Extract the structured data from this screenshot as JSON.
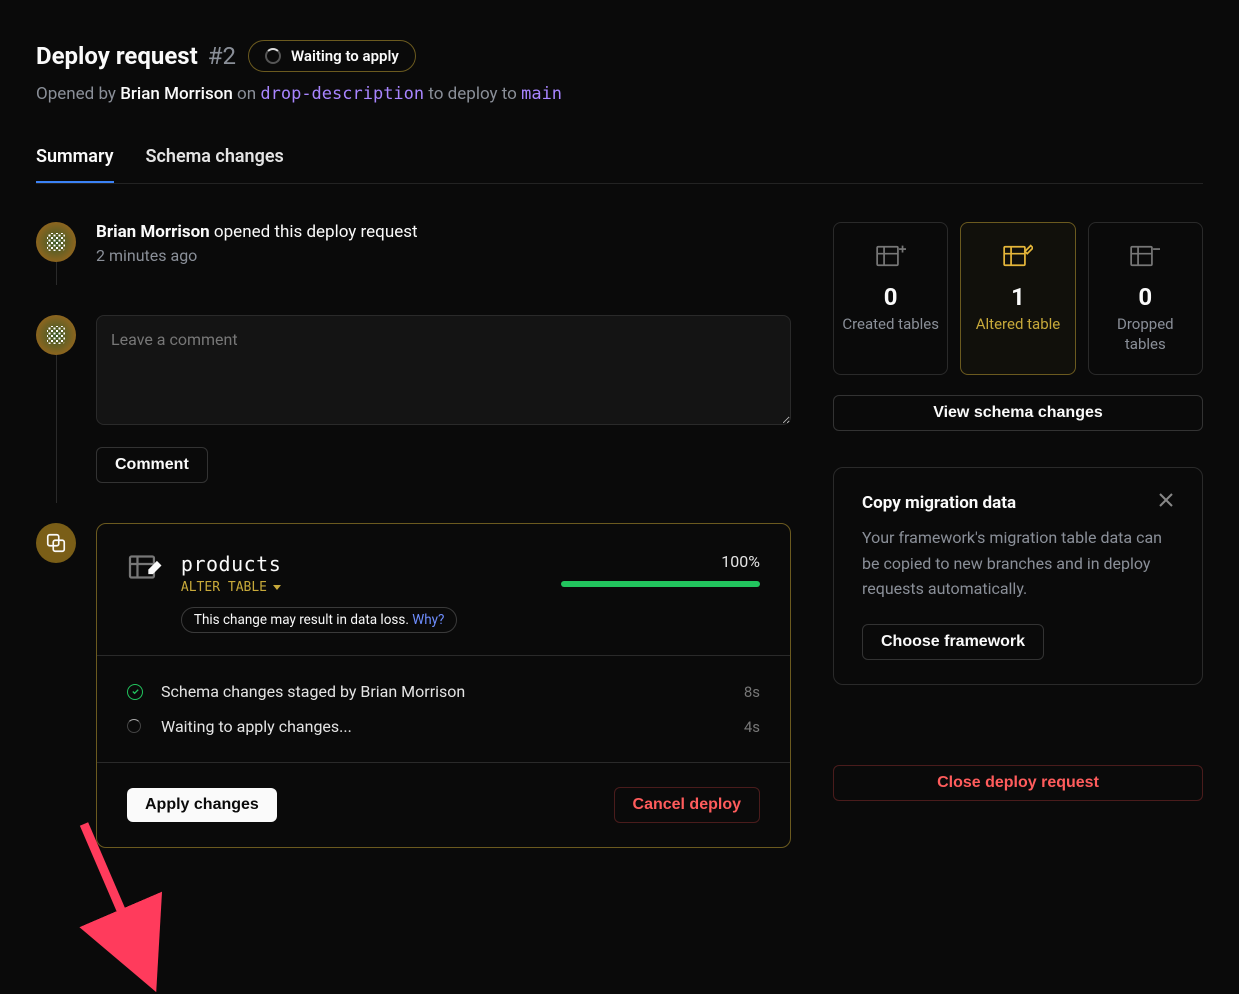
{
  "header": {
    "title": "Deploy request",
    "number": "#2",
    "status_label": "Waiting to apply",
    "opened_by_prefix": "Opened by ",
    "author": "Brian Morrison",
    "on": " on ",
    "source_branch": "drop-description",
    "to_deploy_to": " to deploy to ",
    "target_branch": "main"
  },
  "tabs": {
    "summary": "Summary",
    "schema": "Schema changes"
  },
  "timeline": {
    "opened_author": "Brian Morrison",
    "opened_suffix": " opened this deploy request",
    "opened_time": "2 minutes ago",
    "comment_placeholder": "Leave a comment",
    "comment_button": "Comment"
  },
  "deploy": {
    "table_name": "products",
    "alter_label": "ALTER TABLE",
    "warning_text": "This change may result in data loss. ",
    "warning_why": "Why?",
    "progress_pct": "100%",
    "steps": [
      {
        "text": "Schema changes staged by Brian Morrison",
        "time": "8s",
        "status": "done"
      },
      {
        "text": "Waiting to apply changes...",
        "time": "4s",
        "status": "pending"
      }
    ],
    "apply_button": "Apply changes",
    "cancel_button": "Cancel deploy"
  },
  "sidebar": {
    "stats": {
      "created": {
        "count": "0",
        "label": "Created tables"
      },
      "altered": {
        "count": "1",
        "label": "Altered table"
      },
      "dropped": {
        "count": "0",
        "label": "Dropped tables"
      }
    },
    "view_schema": "View schema changes",
    "migration": {
      "title": "Copy migration data",
      "body": "Your framework's migration table data can be copied to new branches and in deploy requests automatically.",
      "choose_button": "Choose framework"
    },
    "close_request": "Close deploy request"
  }
}
